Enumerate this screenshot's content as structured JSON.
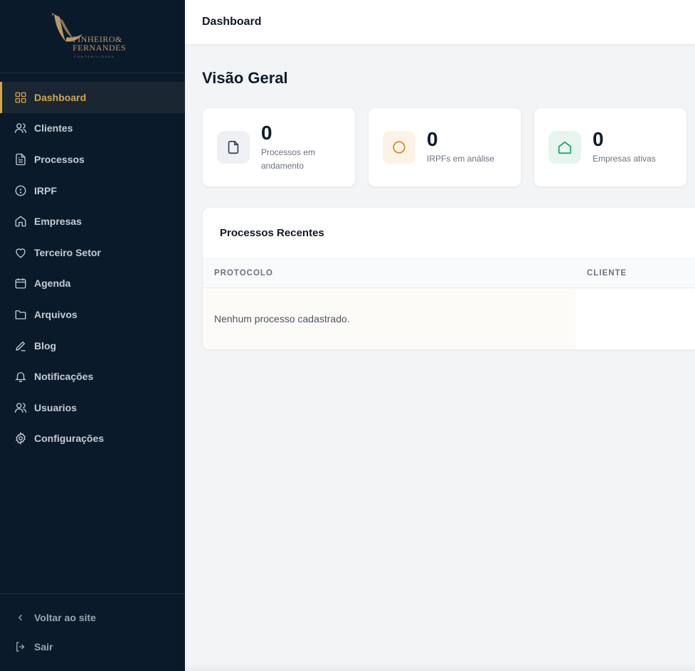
{
  "brand": {
    "line1": "PINHEIRO&",
    "line2": "FERNANDES",
    "sub": "CONTABILIDADE",
    "accent": "#b89a6a"
  },
  "sidebar": {
    "items": [
      {
        "label": "Dashboard",
        "icon": "grid-icon",
        "active": true
      },
      {
        "label": "Clientes",
        "icon": "users-icon"
      },
      {
        "label": "Processos",
        "icon": "file-text-icon"
      },
      {
        "label": "IRPF",
        "icon": "clock-icon"
      },
      {
        "label": "Empresas",
        "icon": "home-icon"
      },
      {
        "label": "Terceiro Setor",
        "icon": "heart-icon"
      },
      {
        "label": "Agenda",
        "icon": "calendar-icon"
      },
      {
        "label": "Arquivos",
        "icon": "folder-icon"
      },
      {
        "label": "Blog",
        "icon": "pen-icon"
      },
      {
        "label": "Notificações",
        "icon": "bell-icon"
      },
      {
        "label": "Usuarios",
        "icon": "users-icon"
      },
      {
        "label": "Configurações",
        "icon": "gear-icon"
      }
    ],
    "footer": [
      {
        "label": "Voltar ao site",
        "icon": "chevron-left-icon"
      },
      {
        "label": "Sair",
        "icon": "logout-icon"
      }
    ],
    "colors": {
      "background": "#0b1a2a",
      "active": "#d6a54a"
    }
  },
  "topbar": {
    "title": "Dashboard"
  },
  "main": {
    "page_title": "Visão Geral",
    "stats": [
      {
        "value": "0",
        "label": "Processos em andamento",
        "icon": "file-icon",
        "color": "#374151",
        "bg": "#eef0f3"
      },
      {
        "value": "0",
        "label": "IRPFs em análise",
        "icon": "circle-icon",
        "color": "#c98a2a",
        "bg": "#fbf3e6"
      },
      {
        "value": "0",
        "label": "Empresas ativas",
        "icon": "home-icon",
        "color": "#16a06a",
        "bg": "#e6f6ef"
      }
    ],
    "recent": {
      "title": "Processos Recentes",
      "columns": [
        "PROTOCOLO",
        "CLIENTE"
      ],
      "empty_text": "Nenhum processo cadastrado."
    }
  }
}
